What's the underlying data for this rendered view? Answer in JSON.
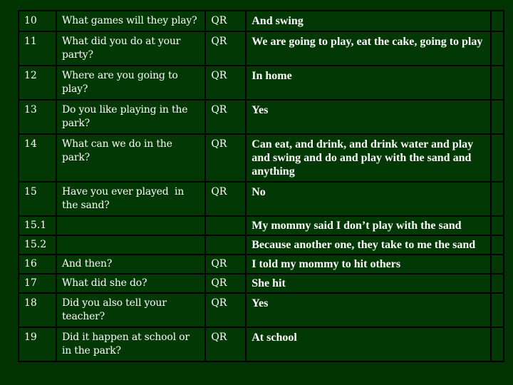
{
  "table": {
    "rows": [
      {
        "num": "10",
        "question": "What games will they play?",
        "code": "QR",
        "answer": "And swing"
      },
      {
        "num": "11",
        "question": "What did you do at your party?",
        "code": "QR",
        "answer": "We are going to play, eat the cake, going to play"
      },
      {
        "num": "12",
        "question": "Where are you going to play?",
        "code": "QR",
        "answer": "In home"
      },
      {
        "num": "13",
        "question": "Do you like playing in the park?",
        "code": "QR",
        "answer": "Yes"
      },
      {
        "num": "14",
        "question": "What can we do in the park?",
        "code": "QR",
        "answer": "Can eat, and drink, and drink water and play and swing and do and play with the sand and anything"
      },
      {
        "num": "15",
        "question": "Have you ever played  in the sand?",
        "code": "QR",
        "answer": "No"
      },
      {
        "num": "15.1",
        "question": "",
        "code": "",
        "answer": "My mommy said I don’t play with the sand"
      },
      {
        "num": "15.2",
        "question": "",
        "code": "",
        "answer": "Because another one, they take to me the sand"
      },
      {
        "num": "16",
        "question": "And then?",
        "code": "QR",
        "answer": "I told my mommy to hit others"
      },
      {
        "num": "17",
        "question": "What did she do?",
        "code": "QR",
        "answer": "She hit"
      },
      {
        "num": "18",
        "question": "Did you also tell your teacher?",
        "code": "QR",
        "answer": "Yes"
      },
      {
        "num": "19",
        "question": "Did it happen at school or in the park?",
        "code": "QR",
        "answer": "At school"
      }
    ]
  },
  "colors": {
    "background": "#013300",
    "cell_background": "#023804",
    "border": "#000000",
    "text": "#ffffff"
  }
}
